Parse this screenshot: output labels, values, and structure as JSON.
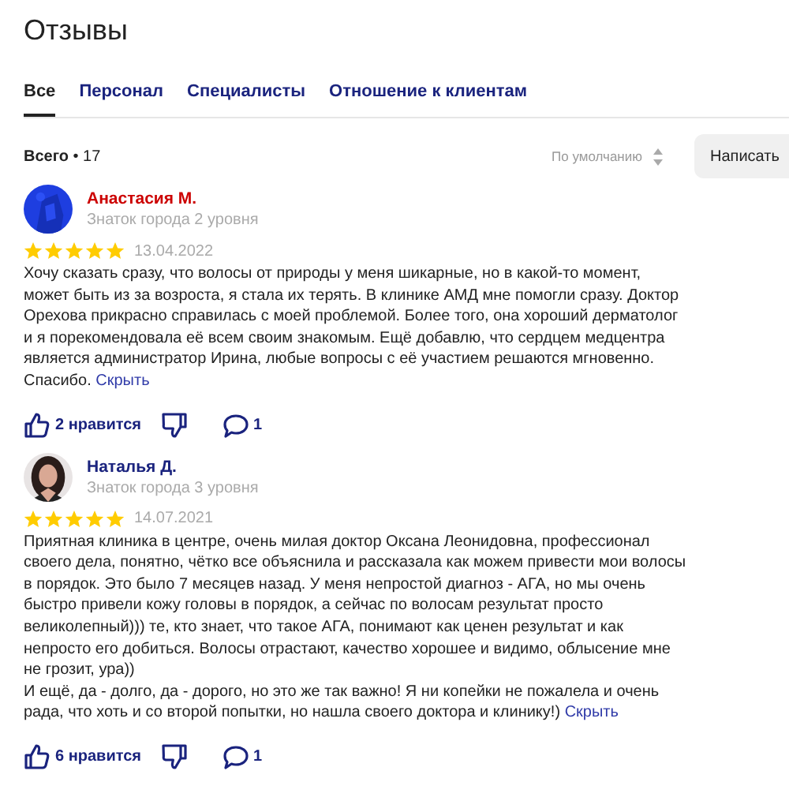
{
  "title": "Отзывы",
  "tabs": [
    {
      "label": "Все",
      "selected": true
    },
    {
      "label": "Персонал",
      "selected": false
    },
    {
      "label": "Специалисты",
      "selected": false
    },
    {
      "label": "Отношение к клиентам",
      "selected": false
    }
  ],
  "total": "**Всего** • 17",
  "sort": {
    "label": "По умолчанию"
  },
  "write_button": "Написать",
  "reviews": [
    {
      "author": {
        "name": "Анастасия М.",
        "color": "#cc0000",
        "level": "Знаток города 2 уровня"
      },
      "stars": 5,
      "date": "13.04.2022",
      "paragraphs": [
        "Хочу сказать сразу, что волосы от природы у меня шикарные, но в какой-то момент, может быть из за возроста, я стала их терять. В клинике АМД мне помогли сразу. Доктор Орехова прикрасно справилась с моей проблемой. Более того, она хороший дерматолог и я порекомендовала её всем своим знакомым. Ещё добавлю, что сердцем медцентра является администратор Ирина, любые вопросы с её участием решаются мгновенно. Спасибо."
      ],
      "collapse_link": "Скрыть",
      "likes": "2 нравится",
      "comments": "1"
    },
    {
      "author": {
        "name": "Наталья Д.",
        "color": "#1a237e",
        "level": "Знаток города 3 уровня"
      },
      "stars": 5,
      "date": "14.07.2021",
      "paragraphs": [
        "Приятная клиника в центре, очень милая доктор Оксана Леонидовна, профессионал своего дела, понятно, чётко все объяснила и рассказала как можем привести мои волосы в порядок. Это было 7 месяцев назад. У меня непростой диагноз - АГА, но мы очень быстро привели кожу головы в порядок, а сейчас по волосам результат просто великолепный))) те, кто знает, что такое АГА, понимают как ценен результат и как непросто его добиться. Волосы отрастают, качество хорошее и видимо, облысение мне не грозит, ура))",
        "И ещё, да - долго, да - дорого, но это же так важно! Я ни копейки не пожалела и очень рада, что хоть и со второй попытки, но нашла своего доктора и клинику!)"
      ],
      "collapse_link": "Скрыть",
      "likes": "6 нравится",
      "comments": "1"
    }
  ]
}
